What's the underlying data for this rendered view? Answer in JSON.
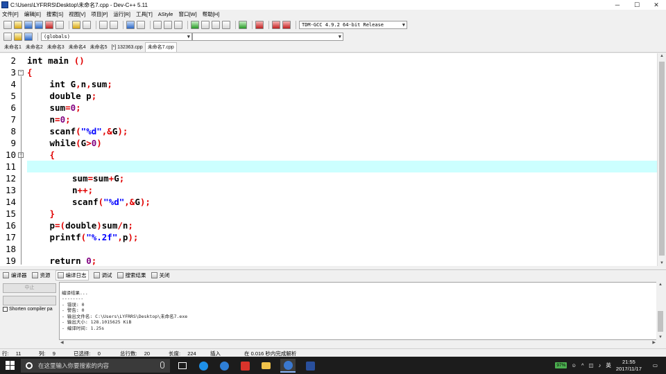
{
  "window": {
    "title": "C:\\Users\\LYFRRS\\Desktop\\未命名7.cpp - Dev-C++ 5.11",
    "controls": {
      "minimize": "─",
      "maximize": "☐",
      "close": "✕"
    }
  },
  "menu": [
    "文件[F]",
    "编辑[E]",
    "搜索[S]",
    "视图[V]",
    "项目[P]",
    "运行[R]",
    "工具[T]",
    "AStyle",
    "窗口[W]",
    "帮助[H]"
  ],
  "toolbar": {
    "compiler_select": "TDM-GCC 4.9.2 64-bit Release",
    "scope_select": "(globals)",
    "symbol_select": ""
  },
  "tabs": [
    "未命名1",
    "未命名2",
    "未命名3",
    "未命名4",
    "未命名5",
    "[*] 132363.cpp",
    "未命名7.cpp"
  ],
  "active_tab_index": 6,
  "editor": {
    "current_line": 11,
    "lines": [
      {
        "num": "2",
        "indent": 0,
        "tokens": [
          {
            "t": "int main ",
            "c": "kw"
          },
          {
            "t": "()",
            "c": "sym"
          }
        ]
      },
      {
        "num": "3",
        "indent": 0,
        "fold": "⊟",
        "tokens": [
          {
            "t": "{",
            "c": "sym"
          }
        ]
      },
      {
        "num": "4",
        "indent": 1,
        "tokens": [
          {
            "t": "int G",
            "c": "kw"
          },
          {
            "t": ",",
            "c": "sym"
          },
          {
            "t": "n",
            "c": "kw"
          },
          {
            "t": ",",
            "c": "sym"
          },
          {
            "t": "sum",
            "c": "kw"
          },
          {
            "t": ";",
            "c": "sym"
          }
        ]
      },
      {
        "num": "5",
        "indent": 1,
        "tokens": [
          {
            "t": "double p",
            "c": "kw"
          },
          {
            "t": ";",
            "c": "sym"
          }
        ]
      },
      {
        "num": "6",
        "indent": 1,
        "tokens": [
          {
            "t": "sum",
            "c": "kw"
          },
          {
            "t": "=",
            "c": "sym"
          },
          {
            "t": "0",
            "c": "num"
          },
          {
            "t": ";",
            "c": "sym"
          }
        ]
      },
      {
        "num": "7",
        "indent": 1,
        "tokens": [
          {
            "t": "n",
            "c": "kw"
          },
          {
            "t": "=",
            "c": "sym"
          },
          {
            "t": "0",
            "c": "num"
          },
          {
            "t": ";",
            "c": "sym"
          }
        ]
      },
      {
        "num": "8",
        "indent": 1,
        "tokens": [
          {
            "t": "scanf",
            "c": "kw"
          },
          {
            "t": "(",
            "c": "sym"
          },
          {
            "t": "\"%d\"",
            "c": "str"
          },
          {
            "t": ",&",
            "c": "sym"
          },
          {
            "t": "G",
            "c": "kw"
          },
          {
            "t": ");",
            "c": "sym"
          }
        ]
      },
      {
        "num": "9",
        "indent": 1,
        "tokens": [
          {
            "t": "while",
            "c": "kw"
          },
          {
            "t": "(",
            "c": "sym"
          },
          {
            "t": "G",
            "c": "kw"
          },
          {
            "t": ">",
            "c": "sym"
          },
          {
            "t": "0",
            "c": "num"
          },
          {
            "t": ")",
            "c": "sym"
          }
        ]
      },
      {
        "num": "10",
        "indent": 1,
        "fold": "⊟",
        "tokens": [
          {
            "t": "{",
            "c": "sym"
          }
        ]
      },
      {
        "num": "11",
        "indent": 0,
        "tokens": []
      },
      {
        "num": "12",
        "indent": 2,
        "tokens": [
          {
            "t": "sum",
            "c": "kw"
          },
          {
            "t": "=",
            "c": "sym"
          },
          {
            "t": "sum",
            "c": "kw"
          },
          {
            "t": "+",
            "c": "sym"
          },
          {
            "t": "G",
            "c": "kw"
          },
          {
            "t": ";",
            "c": "sym"
          }
        ]
      },
      {
        "num": "13",
        "indent": 2,
        "tokens": [
          {
            "t": "n",
            "c": "kw"
          },
          {
            "t": "++;",
            "c": "sym"
          }
        ]
      },
      {
        "num": "14",
        "indent": 2,
        "tokens": [
          {
            "t": "scanf",
            "c": "kw"
          },
          {
            "t": "(",
            "c": "sym"
          },
          {
            "t": "\"%d\"",
            "c": "str"
          },
          {
            "t": ",&",
            "c": "sym"
          },
          {
            "t": "G",
            "c": "kw"
          },
          {
            "t": ");",
            "c": "sym"
          }
        ]
      },
      {
        "num": "15",
        "indent": 1,
        "tokens": [
          {
            "t": "}",
            "c": "sym"
          }
        ]
      },
      {
        "num": "16",
        "indent": 1,
        "tokens": [
          {
            "t": "p",
            "c": "kw"
          },
          {
            "t": "=(",
            "c": "sym"
          },
          {
            "t": "double",
            "c": "kw"
          },
          {
            "t": ")",
            "c": "sym"
          },
          {
            "t": "sum",
            "c": "kw"
          },
          {
            "t": "/",
            "c": "sym"
          },
          {
            "t": "n",
            "c": "kw"
          },
          {
            "t": ";",
            "c": "sym"
          }
        ]
      },
      {
        "num": "17",
        "indent": 1,
        "tokens": [
          {
            "t": "printf",
            "c": "kw"
          },
          {
            "t": "(",
            "c": "sym"
          },
          {
            "t": "\"%.2f\"",
            "c": "str"
          },
          {
            "t": ",",
            "c": "sym"
          },
          {
            "t": "p",
            "c": "kw"
          },
          {
            "t": ");",
            "c": "sym"
          }
        ]
      },
      {
        "num": "18",
        "indent": 0,
        "tokens": []
      },
      {
        "num": "19",
        "indent": 1,
        "tokens": [
          {
            "t": "return ",
            "c": "kw"
          },
          {
            "t": "0",
            "c": "num"
          },
          {
            "t": ";",
            "c": "sym"
          }
        ]
      }
    ]
  },
  "bottom_tabs": [
    "编译器",
    "资源",
    "编译日志",
    "调试",
    "搜索结果",
    "关闭"
  ],
  "active_bottom_tab_index": 2,
  "left_panel": {
    "abort_button": "中止",
    "shorten_label": "Shorten compiler pa"
  },
  "output": {
    "lines": [
      "编译结果...",
      "--------",
      "- 错误: 0",
      "- 警告: 0",
      "- 输出文件名: C:\\Users\\LYFRRS\\Desktop\\未命名7.exe",
      "- 输出大小: 128.1015625 KiB",
      "- 编译时间: 1.25s"
    ]
  },
  "status": {
    "row_label": "行:",
    "row": "11",
    "col_label": "列:",
    "col": "9",
    "sel_label": "已选择:",
    "sel": "0",
    "total_label": "总行数:",
    "total": "20",
    "len_label": "长度:",
    "len": "224",
    "mode": "插入",
    "parse": "在 0.016 秒内完成解析"
  },
  "taskbar": {
    "search_placeholder": "在这里输入你要搜索的内容",
    "battery": "97%",
    "ime": "英",
    "time": "21:55",
    "date": "2017/11/17"
  }
}
